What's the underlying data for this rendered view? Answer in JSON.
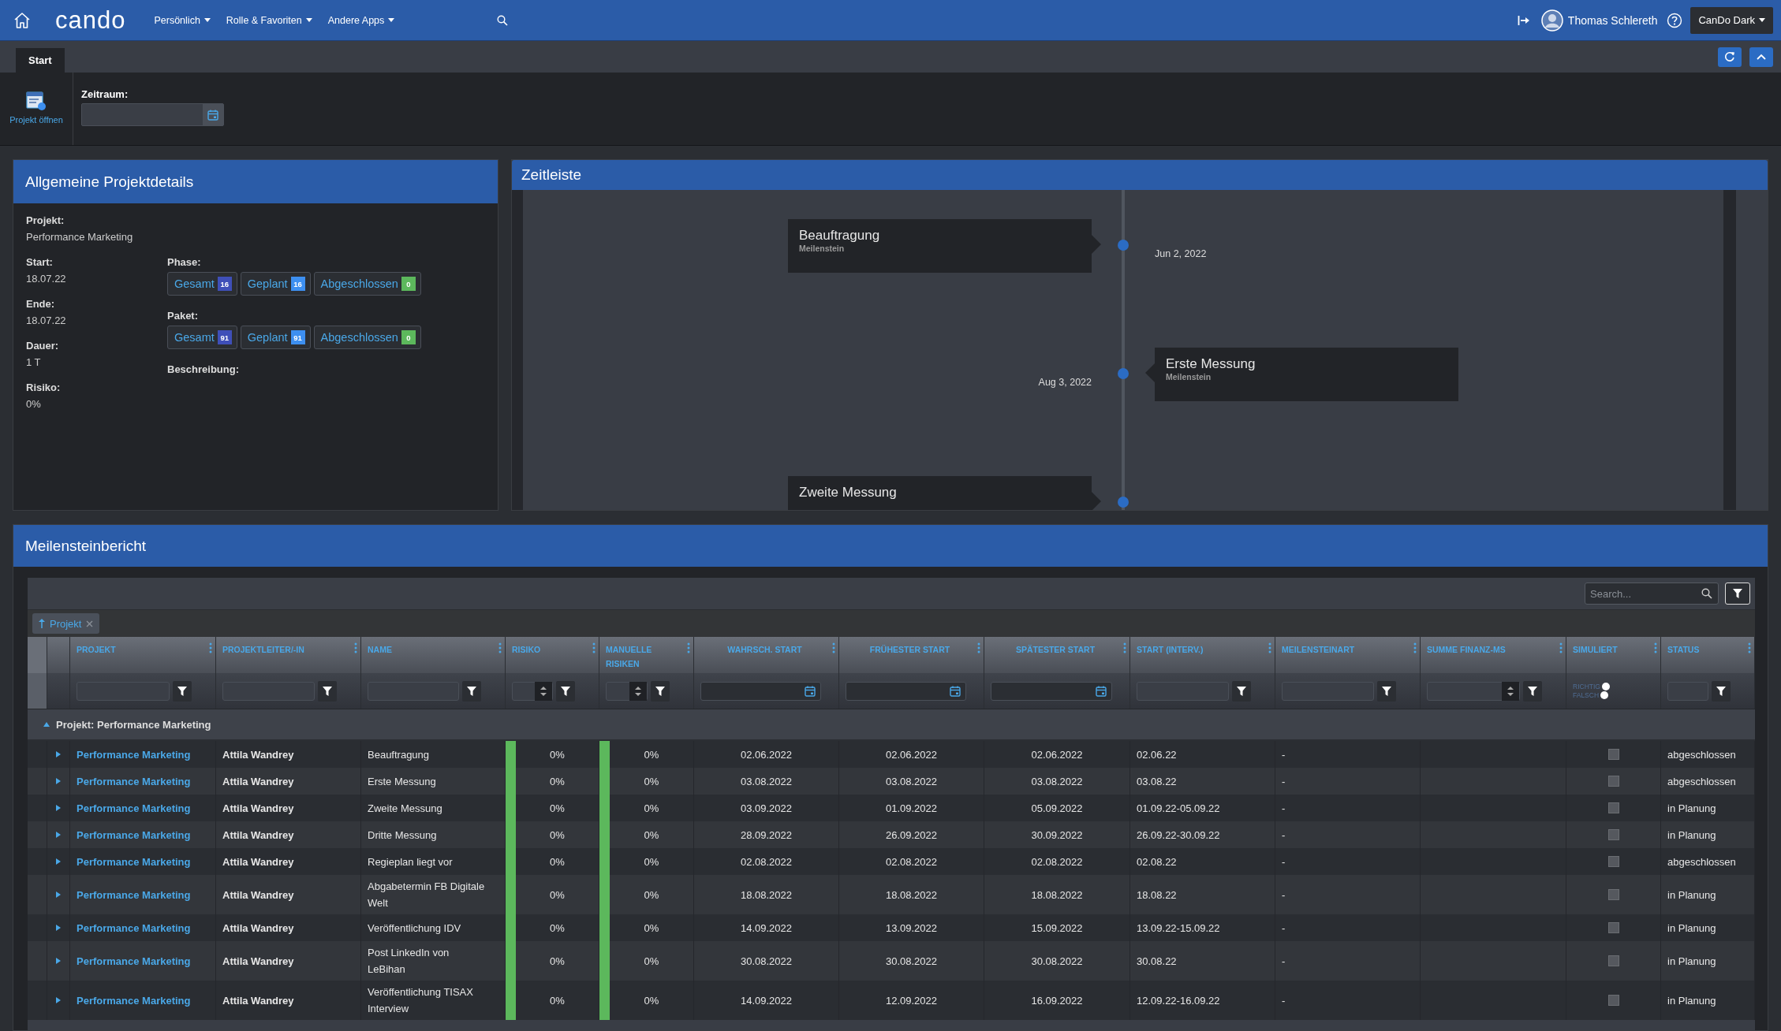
{
  "topbar": {
    "logo": "cando",
    "menus": [
      {
        "label": "Persönlich"
      },
      {
        "label": "Rolle & Favoriten"
      },
      {
        "label": "Andere Apps"
      }
    ],
    "user": {
      "name": "Thomas Schlereth"
    },
    "theme": {
      "label": "CanDo Dark"
    }
  },
  "tabs": [
    {
      "label": "Start",
      "selected": true
    }
  ],
  "toolbar": {
    "open_project": "Projekt öffnen",
    "period_label": "Zeitraum:"
  },
  "details": {
    "title": "Allgemeine Projektdetails",
    "project": {
      "label": "Projekt:",
      "value": "Performance Marketing"
    },
    "fields": [
      {
        "label": "Start:",
        "value": "18.07.22"
      },
      {
        "label": "Ende:",
        "value": "18.07.22"
      },
      {
        "label": "Dauer:",
        "value": "1 T"
      },
      {
        "label": "Risiko:",
        "value": "0%"
      }
    ],
    "groups": [
      {
        "label": "Phase:",
        "counts": [
          {
            "label": "Gesamt",
            "count": "16",
            "color": "#3f4fb8"
          },
          {
            "label": "Geplant",
            "count": "16",
            "color": "#3d8ff0"
          },
          {
            "label": "Abgeschlossen",
            "count": "0",
            "color": "#5cb85c"
          }
        ]
      },
      {
        "label": "Paket:",
        "counts": [
          {
            "label": "Gesamt",
            "count": "91",
            "color": "#3f4fb8"
          },
          {
            "label": "Geplant",
            "count": "91",
            "color": "#3d8ff0"
          },
          {
            "label": "Abgeschlossen",
            "count": "0",
            "color": "#5cb85c"
          }
        ]
      }
    ],
    "description_label": "Beschreibung:"
  },
  "timeline": {
    "title": "Zeitleiste",
    "events": [
      {
        "title": "Beauftragung",
        "type": "Meilenstein",
        "date": "Jun 2, 2022",
        "kind": "left"
      },
      {
        "title": "Erste Messung",
        "type": "Meilenstein",
        "date": "Aug 3, 2022",
        "kind": "right"
      },
      {
        "title": "Zweite Messung",
        "kind": "left"
      }
    ]
  },
  "report": {
    "title": "Meilensteinbericht",
    "search": {
      "placeholder": "Search..."
    },
    "group_chip": {
      "label": "Projekt"
    },
    "columns": [
      {
        "label": "PROJEKT",
        "kind": "text"
      },
      {
        "label": "PROJEKTLEITER/-IN",
        "kind": "text"
      },
      {
        "label": "NAME",
        "kind": "text"
      },
      {
        "label": "RISIKO",
        "kind": "number"
      },
      {
        "label": "MANUELLE RISIKEN",
        "kind": "number"
      },
      {
        "label": "WAHRSCH. START",
        "kind": "date"
      },
      {
        "label": "FRÜHESTER START",
        "kind": "date"
      },
      {
        "label": "SPÄTESTER START",
        "kind": "date"
      },
      {
        "label": "START (INTERV.)",
        "kind": "text"
      },
      {
        "label": "MEILENSTEINART",
        "kind": "text"
      },
      {
        "label": "SUMME FINANZ-MS",
        "kind": "number"
      },
      {
        "label": "SIMULIERT",
        "kind": "radio"
      },
      {
        "label": "STATUS",
        "kind": "text"
      }
    ],
    "simulated_options": [
      {
        "label": "RICHTIG",
        "selected": false
      },
      {
        "label": "FALSCH",
        "selected": false
      }
    ],
    "group": {
      "label": "Projekt: Performance Marketing",
      "expanded": true
    },
    "rows": [
      {
        "projekt": "Performance Marketing",
        "projektleiter": "Attila Wandrey",
        "name": "Beauftragung",
        "risiko": {
          "text": "0%",
          "color": "#5cb85c"
        },
        "manuelle_risiken": {
          "text": "0%",
          "color": "#5cb85c"
        },
        "wahrsch_start": "02.06.2022",
        "fruehester_start": "02.06.2022",
        "spaetester_start": "02.06.2022",
        "start_interv": "02.06.22",
        "meilensteinart": "-",
        "simuliert": false,
        "status": "abgeschlossen"
      },
      {
        "projekt": "Performance Marketing",
        "projektleiter": "Attila Wandrey",
        "name": "Erste Messung",
        "risiko": {
          "text": "0%",
          "color": "#5cb85c"
        },
        "manuelle_risiken": {
          "text": "0%",
          "color": "#5cb85c"
        },
        "wahrsch_start": "03.08.2022",
        "fruehester_start": "03.08.2022",
        "spaetester_start": "03.08.2022",
        "start_interv": "03.08.22",
        "meilensteinart": "-",
        "simuliert": false,
        "status": "abgeschlossen"
      },
      {
        "projekt": "Performance Marketing",
        "projektleiter": "Attila Wandrey",
        "name": "Zweite Messung",
        "risiko": {
          "text": "0%",
          "color": "#5cb85c"
        },
        "manuelle_risiken": {
          "text": "0%",
          "color": "#5cb85c"
        },
        "wahrsch_start": "03.09.2022",
        "fruehester_start": "01.09.2022",
        "spaetester_start": "05.09.2022",
        "start_interv": "01.09.22-05.09.22",
        "meilensteinart": "-",
        "simuliert": false,
        "status": "in Planung"
      },
      {
        "projekt": "Performance Marketing",
        "projektleiter": "Attila Wandrey",
        "name": "Dritte Messung",
        "risiko": {
          "text": "0%",
          "color": "#5cb85c"
        },
        "manuelle_risiken": {
          "text": "0%",
          "color": "#5cb85c"
        },
        "wahrsch_start": "28.09.2022",
        "fruehester_start": "26.09.2022",
        "spaetester_start": "30.09.2022",
        "start_interv": "26.09.22-30.09.22",
        "meilensteinart": "-",
        "simuliert": false,
        "status": "in Planung"
      },
      {
        "projekt": "Performance Marketing",
        "projektleiter": "Attila Wandrey",
        "name": "Regieplan liegt vor",
        "risiko": {
          "text": "0%",
          "color": "#5cb85c"
        },
        "manuelle_risiken": {
          "text": "0%",
          "color": "#5cb85c"
        },
        "wahrsch_start": "02.08.2022",
        "fruehester_start": "02.08.2022",
        "spaetester_start": "02.08.2022",
        "start_interv": "02.08.22",
        "meilensteinart": "-",
        "simuliert": false,
        "status": "abgeschlossen"
      },
      {
        "projekt": "Performance Marketing",
        "projektleiter": "Attila Wandrey",
        "name": "Abgabetermin FB Digitale Welt",
        "risiko": {
          "text": "0%",
          "color": "#5cb85c"
        },
        "manuelle_risiken": {
          "text": "0%",
          "color": "#5cb85c"
        },
        "wahrsch_start": "18.08.2022",
        "fruehester_start": "18.08.2022",
        "spaetester_start": "18.08.2022",
        "start_interv": "18.08.22",
        "meilensteinart": "-",
        "simuliert": false,
        "status": "in Planung"
      },
      {
        "projekt": "Performance Marketing",
        "projektleiter": "Attila Wandrey",
        "name": "Veröffentlichung IDV",
        "risiko": {
          "text": "0%",
          "color": "#5cb85c"
        },
        "manuelle_risiken": {
          "text": "0%",
          "color": "#5cb85c"
        },
        "wahrsch_start": "14.09.2022",
        "fruehester_start": "13.09.2022",
        "spaetester_start": "15.09.2022",
        "start_interv": "13.09.22-15.09.22",
        "meilensteinart": "-",
        "simuliert": false,
        "status": "in Planung"
      },
      {
        "projekt": "Performance Marketing",
        "projektleiter": "Attila Wandrey",
        "name": "Post LinkedIn von LeBihan",
        "risiko": {
          "text": "0%",
          "color": "#5cb85c"
        },
        "manuelle_risiken": {
          "text": "0%",
          "color": "#5cb85c"
        },
        "wahrsch_start": "30.08.2022",
        "fruehester_start": "30.08.2022",
        "spaetester_start": "30.08.2022",
        "start_interv": "30.08.22",
        "meilensteinart": "-",
        "simuliert": false,
        "status": "in Planung"
      },
      {
        "projekt": "Performance Marketing",
        "projektleiter": "Attila Wandrey",
        "name": "Veröffentlichung TISAX Interview",
        "risiko": {
          "text": "0%",
          "color": "#5cb85c"
        },
        "manuelle_risiken": {
          "text": "0%",
          "color": "#5cb85c"
        },
        "wahrsch_start": "14.09.2022",
        "fruehester_start": "12.09.2022",
        "spaetester_start": "16.09.2022",
        "start_interv": "12.09.22-16.09.22",
        "meilensteinart": "-",
        "simuliert": false,
        "status": "in Planung"
      }
    ]
  }
}
